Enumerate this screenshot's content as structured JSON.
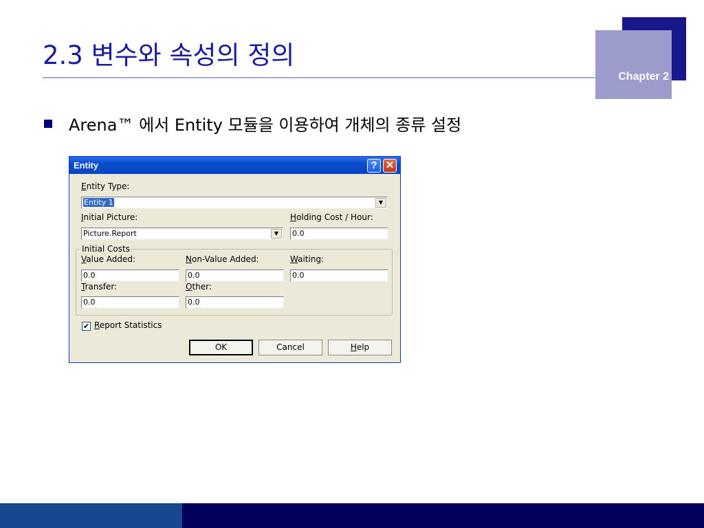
{
  "slide": {
    "title": "2.3 변수와 속성의 정의",
    "chapter": "Chapter 2",
    "bullet": "Arena™ 에서 Entity 모듈을 이용하여 개체의 종류 설정"
  },
  "dialog": {
    "title": "Entity",
    "help_glyph": "?",
    "close_glyph": "✕",
    "entity_type_label_key": "E",
    "entity_type_label_rest": "ntity Type:",
    "entity_type_value": "Entity 1",
    "initial_picture_label_key": "I",
    "initial_picture_label_rest": "nitial Picture:",
    "initial_picture_value": "Picture.Report",
    "holding_cost_label_key": "H",
    "holding_cost_label_rest": "olding Cost / Hour:",
    "holding_cost_value": "0.0",
    "initial_costs_group": "Initial Costs",
    "value_added_label_key": "V",
    "value_added_label_rest": "alue Added:",
    "value_added_value": "0.0",
    "non_value_added_label_key": "N",
    "non_value_added_label_rest": "on-Value Added:",
    "non_value_added_value": "0.0",
    "waiting_label_key": "W",
    "waiting_label_rest": "aiting:",
    "waiting_value": "0.0",
    "transfer_label_key": "T",
    "transfer_label_rest": "ransfer:",
    "transfer_value": "0.0",
    "other_label_key": "O",
    "other_label_rest": "ther:",
    "other_value": "0.0",
    "report_statistics_key": "R",
    "report_statistics_rest": "eport Statistics",
    "report_statistics_checked": true,
    "check_glyph": "✔",
    "dropdown_glyph": "▼",
    "ok_label": "OK",
    "cancel_label": "Cancel",
    "help_label_key": "H",
    "help_label_rest": "elp"
  },
  "colors": {
    "title_text": "#1a1a9e",
    "chapter_box_dark": "#18188c",
    "chapter_box_light": "#9c9ccc",
    "footer_left": "#17478f",
    "footer_right": "#00005a",
    "dialog_face": "#ece9d8",
    "titlebar_blue": "#0a4ccc"
  }
}
